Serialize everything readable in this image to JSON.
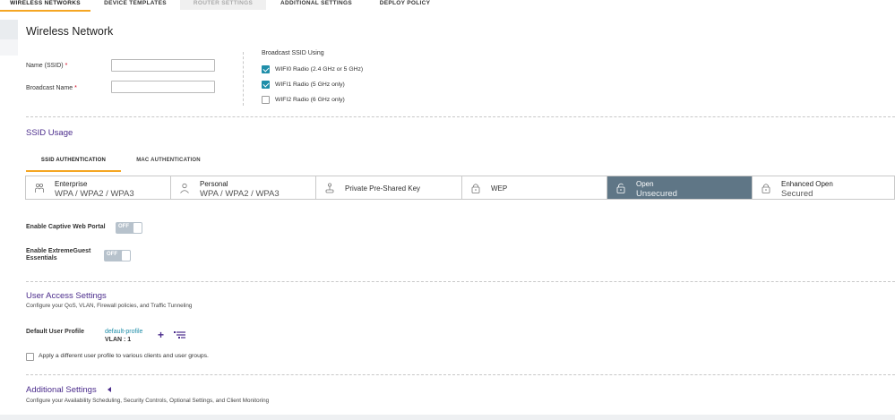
{
  "top_tabs": [
    {
      "label": "WIRELESS NETWORKS"
    },
    {
      "label": "DEVICE TEMPLATES"
    },
    {
      "label": "ROUTER SETTINGS"
    },
    {
      "label": "ADDITIONAL SETTINGS"
    },
    {
      "label": "DEPLOY POLICY"
    }
  ],
  "page_title": "Wireless Network",
  "form": {
    "ssid_label": "Name (SSID)",
    "broadcast_name_label": "Broadcast Name",
    "required_mark": "*",
    "ssid_value": "",
    "broadcast_value": ""
  },
  "broadcast": {
    "heading": "Broadcast SSID Using",
    "radios": [
      {
        "label": "WIFI0 Radio (2.4 GHz or 5 GHz)",
        "checked": true
      },
      {
        "label": "WIFI1 Radio (5 GHz only)",
        "checked": true
      },
      {
        "label": "WIFI2 Radio (6 GHz only)",
        "checked": false
      }
    ]
  },
  "ssid_usage": {
    "title": "SSID Usage",
    "tabs": [
      {
        "label": "SSID AUTHENTICATION",
        "active": true
      },
      {
        "label": "MAC AUTHENTICATION",
        "active": false
      }
    ],
    "auth_options": [
      {
        "title": "Enterprise",
        "subtitle": "WPA / WPA2 / WPA3",
        "icon": "enterprise-users-icon"
      },
      {
        "title": "Personal",
        "subtitle": "WPA / WPA2 / WPA3",
        "icon": "person-icon"
      },
      {
        "title": "Private Pre-Shared Key",
        "subtitle": "",
        "icon": "key-joystick-icon"
      },
      {
        "title": "WEP",
        "subtitle": "",
        "icon": "padlock-icon"
      },
      {
        "title": "Open",
        "subtitle": "Unsecured",
        "icon": "open-padlock-icon",
        "selected": true
      },
      {
        "title": "Enhanced Open",
        "subtitle": "Secured",
        "icon": "padlock-icon"
      }
    ]
  },
  "toggles": {
    "captive_label": "Enable Captive Web Portal",
    "captive_state": "OFF",
    "guest_label_line1": "Enable ExtremeGuest",
    "guest_label_line2": "Essentials",
    "guest_state": "OFF"
  },
  "user_access": {
    "title": "User Access Settings",
    "subtitle": "Configure your QoS, VLAN, Firewall policies, and Traffic Tunneling",
    "profile_label": "Default User Profile",
    "profile_name": "default-profile",
    "vlan": "VLAN : 1",
    "plus_glyph": "+",
    "apply_label": "Apply a different user profile to various clients and user groups."
  },
  "additional": {
    "title": "Additional Settings",
    "subtitle": "Configure your Availability Scheduling, Security Controls, Optional Settings, and Client Monitoring"
  },
  "colors": {
    "accent": "#f5a623",
    "section": "#4b2c8c",
    "link": "#1f8ea9",
    "selected_card": "#5f7686"
  }
}
